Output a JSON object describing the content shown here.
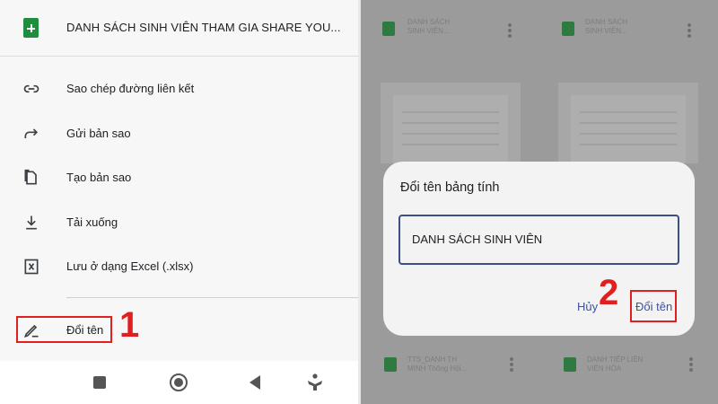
{
  "left_panel": {
    "header": {
      "file_icon": "sheets-icon",
      "title": "DANH SÁCH SINH VIÊN THAM GIA SHARE YOU..."
    },
    "menu": [
      {
        "icon": "link-icon",
        "label": "Sao chép đường liên kết"
      },
      {
        "icon": "share-arrow-icon",
        "label": "Gửi bản sao"
      },
      {
        "icon": "copy-icon",
        "label": "Tạo bản sao"
      },
      {
        "icon": "download-icon",
        "label": "Tải xuống"
      },
      {
        "icon": "excel-icon",
        "label": "Lưu ở dạng Excel (.xlsx)"
      },
      {
        "icon": "pencil-icon",
        "label": "Đổi tên"
      }
    ],
    "step_marker": "1",
    "navbar": [
      "square-nav-icon",
      "home-circle-icon",
      "back-triangle-icon",
      "accessibility-icon"
    ]
  },
  "right_panel": {
    "dialog": {
      "title": "Đổi tên bảng tính",
      "input_value": "DANH SÁCH SINH VIÊN",
      "cancel_label": "Hủy",
      "confirm_label": "Đổi tên"
    },
    "step_marker": "2",
    "background_files": [
      {
        "name_line1": "DANH SÁCH",
        "name_line2": "SINH VIÊN..."
      },
      {
        "name_line1": "DANH SÁCH",
        "name_line2": "SINH VIÊN..."
      },
      {
        "name_line1": "TTS_DANH TH",
        "name_line2": "MINH Thông Hội..."
      },
      {
        "name_line1": "DANH TIẾP LIÊN",
        "name_line2": "VIÊN HÓA"
      }
    ]
  },
  "colors": {
    "highlight_red": "#e02020",
    "accent_blue": "#3c52a3",
    "sheets_green": "#1e8e3e"
  }
}
